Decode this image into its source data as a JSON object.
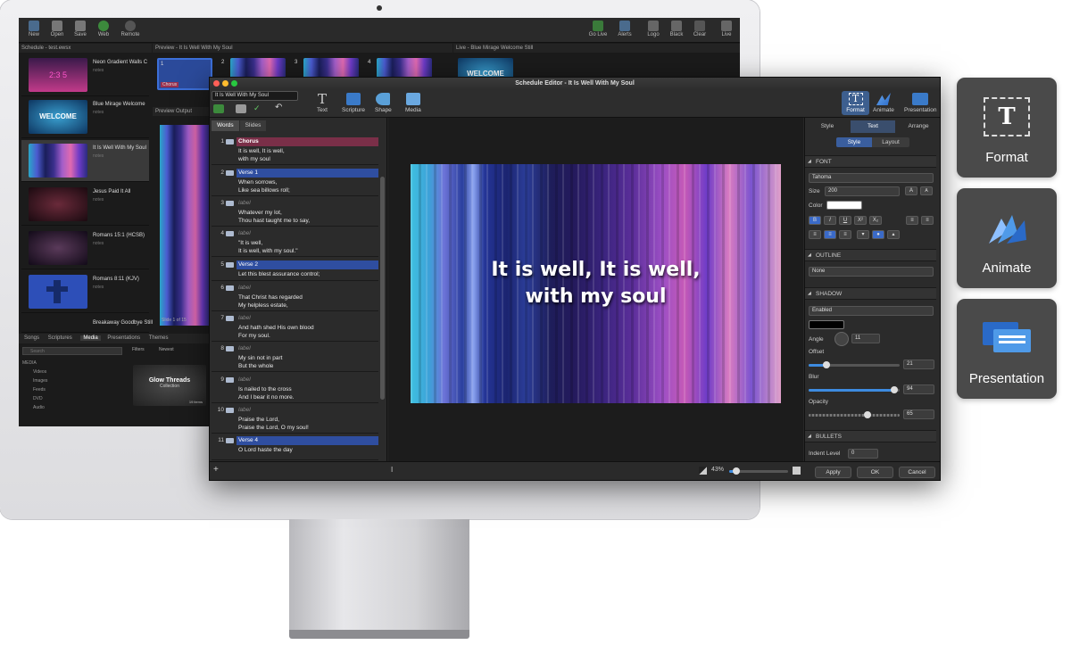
{
  "main_app": {
    "toolbar": {
      "new": "New",
      "open": "Open",
      "save": "Save",
      "web": "Web",
      "remote": "Remote",
      "go_live": "Go Live",
      "alerts": "Alerts",
      "logo": "Logo",
      "black": "Black",
      "clear": "Clear",
      "live": "Live"
    },
    "schedule_title": "Schedule - test.ewsx",
    "preview_title": "Preview - It Is Well With My Soul",
    "live_title": "Live - Blue Mirage Welcome Still",
    "preview_output": "Preview Output",
    "slide_count": "Slide 1 of 15",
    "chorus_badge": "Chorus",
    "welcome": "WELCOME",
    "thumb_2_3_5": "2:3 5",
    "schedule_items": [
      {
        "title": "Neon Gradient Walls C",
        "note": "notes"
      },
      {
        "title": "Blue Mirage Welcome",
        "note": "notes"
      },
      {
        "title": "It Is Well With My Soul",
        "note": "notes"
      },
      {
        "title": "Jesus Paid It All",
        "note": "notes"
      },
      {
        "title": "Romans 15:1 (HCSB)",
        "note": "notes"
      },
      {
        "title": "Romans 8:11 (KJV)",
        "note": "notes"
      },
      {
        "title": "Breakaway Goodbye Still",
        "note": ""
      }
    ],
    "preview_nums": [
      "1",
      "2",
      "3",
      "4"
    ],
    "lib_tabs": [
      "Songs",
      "Scriptures",
      "Media",
      "Presentations",
      "Themes"
    ],
    "search_placeholder": "Search",
    "filters": "Filters",
    "newest": "Newest",
    "media_label": "MEDIA",
    "media_items": [
      "Videos",
      "Images",
      "Feeds",
      "DVD",
      "Audio"
    ],
    "glow_title": "Glow Threads",
    "glow_sub": "Collection",
    "glow_count": "19 items"
  },
  "editor": {
    "title": "Schedule Editor - It Is Well With My Soul",
    "song_field": "It Is Well With My Soul",
    "tools": {
      "text": "Text",
      "scripture": "Scripture",
      "shape": "Shape",
      "media": "Media",
      "format": "Format",
      "animate": "Animate",
      "presentation": "Presentation"
    },
    "left_tabs": {
      "words": "Words",
      "slides": "Slides"
    },
    "slides": [
      {
        "num": "1",
        "label": "Chorus",
        "text": "It is well, It is well,\nwith my soul",
        "style": "chorus"
      },
      {
        "num": "2",
        "label": "Verse 1",
        "text": "When sorrows,\nLike sea billows roll;",
        "style": "verse"
      },
      {
        "num": "3",
        "label": "label",
        "text": "Whatever my lot,\nThou hast taught me to say,",
        "style": "plain"
      },
      {
        "num": "4",
        "label": "label",
        "text": "\"It is well,\nIt is well, with my soul.\"",
        "style": "plain"
      },
      {
        "num": "5",
        "label": "Verse 2",
        "text": "Let this blest assurance control;",
        "style": "verse"
      },
      {
        "num": "6",
        "label": "label",
        "text": "That Christ has regarded\nMy helpless estate,",
        "style": "plain"
      },
      {
        "num": "7",
        "label": "label",
        "text": "And hath shed His own blood\nFor my soul.",
        "style": "plain"
      },
      {
        "num": "8",
        "label": "label",
        "text": "My sin not in part\nBut the whole",
        "style": "plain"
      },
      {
        "num": "9",
        "label": "label",
        "text": "Is nailed to the cross\nAnd I bear it no more.",
        "style": "plain"
      },
      {
        "num": "10",
        "label": "label",
        "text": "Praise the Lord,\nPraise the Lord, O my soul!",
        "style": "plain"
      },
      {
        "num": "11",
        "label": "Verse 4",
        "text": "O Lord haste the day",
        "style": "verse"
      }
    ],
    "lyric": "It is well, It is well,\nwith my soul",
    "zoom": "43%",
    "right_tabs": {
      "style": "Style",
      "text": "Text",
      "arrange": "Arrange"
    },
    "sub_tabs": {
      "style": "Style",
      "layout": "Layout"
    },
    "font": {
      "header": "FONT",
      "family": "Tahoma",
      "size_label": "Size",
      "size": "200",
      "color_label": "Color",
      "grow": "A",
      "shrink": "A"
    },
    "format_buttons": {
      "bold": "B",
      "italic": "I",
      "underline": "U",
      "superscript": "X²",
      "subscript": "X₂"
    },
    "outline": {
      "header": "OUTLINE",
      "value": "None"
    },
    "shadow": {
      "header": "SHADOW",
      "value": "Enabled",
      "angle_label": "Angle",
      "angle": "11",
      "offset_label": "Offset",
      "offset": "21",
      "offset_level": 0.2,
      "blur_label": "Blur",
      "blur": "94",
      "blur_level": 0.94,
      "opacity_label": "Opacity",
      "opacity": "65",
      "opacity_level": 0.65
    },
    "bullets": {
      "header": "BULLETS",
      "indent_label": "Indent Level",
      "indent": "0"
    },
    "buttons": {
      "apply": "Apply",
      "ok": "OK",
      "cancel": "Cancel"
    }
  },
  "feature_cards": [
    {
      "label": "Format",
      "icon": "format-icon"
    },
    {
      "label": "Animate",
      "icon": "animate-icon"
    },
    {
      "label": "Presentation",
      "icon": "presentation-icon"
    }
  ]
}
